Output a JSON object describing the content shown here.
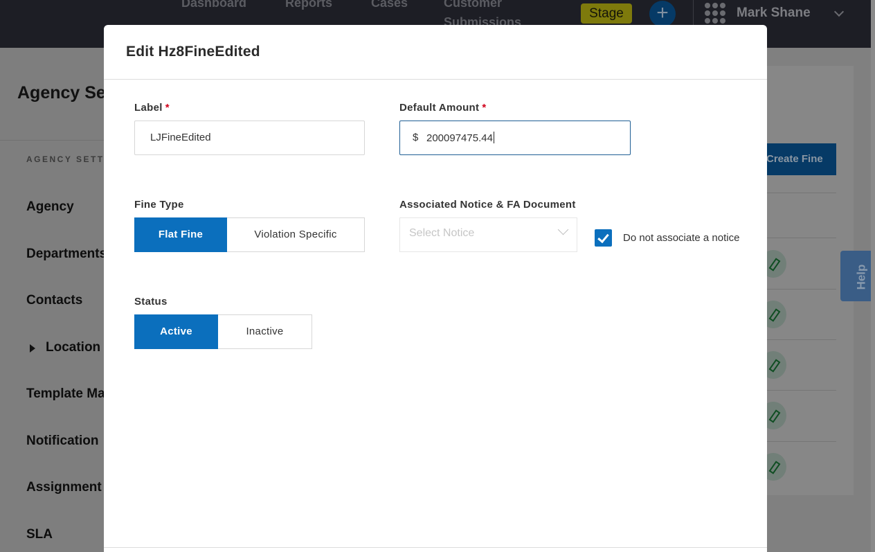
{
  "topbar": {
    "nav": [
      "Dashboard",
      "Reports",
      "Cases",
      "Customer Submissions"
    ],
    "nav_line1": "Customer",
    "nav_line2": "Submissions",
    "env_badge": "Stage",
    "add_icon": "plus-icon",
    "apps_icon": "grid-apps-icon",
    "user_name": "Mark Shane"
  },
  "sidebar": {
    "page_title": "Agency Set",
    "section_header": "AGENCY SETTIN",
    "items": [
      "Agency",
      "Departments",
      "Contacts",
      "Location",
      "Template Ma",
      "Notification",
      "Assignment",
      "SLA"
    ]
  },
  "content": {
    "create_button": "Create Fine",
    "help_tab": "Help"
  },
  "modal": {
    "title": "Edit Hz8FineEdited",
    "label_field": {
      "label": "Label",
      "required_mark": "*",
      "value": "LJFineEdited"
    },
    "amount_field": {
      "label": "Default Amount",
      "required_mark": "*",
      "currency": "$",
      "value": "200097475.44"
    },
    "fine_type": {
      "label": "Fine Type",
      "options": [
        "Flat Fine",
        "Violation Specific"
      ],
      "selected": "Flat Fine"
    },
    "notice": {
      "label": "Associated Notice & FA Document",
      "placeholder": "Select Notice",
      "checkbox_label": "Do not associate a notice",
      "checkbox_checked": true
    },
    "status": {
      "label": "Status",
      "options": [
        "Active",
        "Inactive"
      ],
      "selected": "Active"
    }
  },
  "colors": {
    "primary": "#0b6fbd",
    "required": "#d0021b",
    "topbar": "#1d1e25"
  }
}
